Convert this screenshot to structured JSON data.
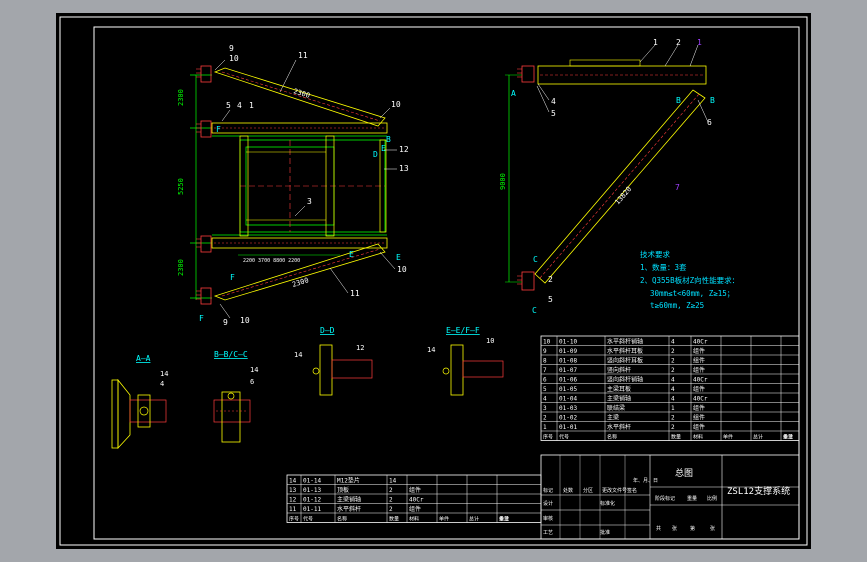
{
  "colors": {
    "background_outer": "#a3a6ab",
    "sheet": "#000000",
    "frame": "#ffffff",
    "dimension": "#00ff00",
    "part": "#ffff00",
    "accent": "#ff3c3c",
    "leader": "#00ffff",
    "purple": "#a040ff",
    "note": "#00e0ff"
  },
  "top_view": {
    "balloons": [
      "9",
      "10",
      "11",
      "5",
      "4",
      "1",
      "10",
      "12",
      "13",
      "3",
      "11",
      "10",
      "9",
      "10"
    ],
    "dims": [
      "2300",
      "2300",
      "5250",
      "2300",
      "2300"
    ],
    "mid_text": "2200   3700  8800  2200",
    "sections": [
      "B",
      "D",
      "E",
      "F",
      "F",
      "F",
      "E",
      "E"
    ]
  },
  "side_view": {
    "balloons": [
      "1",
      "2",
      "1",
      "4",
      "5",
      "6",
      "7",
      "2",
      "5"
    ],
    "dims": [
      "9000",
      "13820"
    ],
    "letters": [
      "A",
      "B",
      "B",
      "C",
      "C"
    ]
  },
  "notes": {
    "title": "技术要求",
    "line1": "1、数量：3套",
    "line2": "2、Q355B板材Z向性能要求：",
    "line3": "30mm≤t<60mm, Z≥15；",
    "line4": "t≥60mm, Z≥25"
  },
  "section_views": {
    "aa": {
      "title": "A—A",
      "b1": "14",
      "b2": "4"
    },
    "bc": {
      "title": "B—B/C—C",
      "b1": "14",
      "b2": "6"
    },
    "dd": {
      "title": "D—D",
      "b1": "14",
      "b2": "12"
    },
    "ef": {
      "title": "E—E/F—F",
      "b1": "14",
      "b2": "10"
    }
  },
  "bom_right": {
    "rows": [
      [
        "10",
        "01-10",
        "水平斜杆销轴",
        "4",
        "40Cr"
      ],
      [
        "9",
        "01-09",
        "水平斜杆耳板",
        "2",
        "组件"
      ],
      [
        "8",
        "01-08",
        "竖向斜杆耳板",
        "2",
        "组件"
      ],
      [
        "7",
        "01-07",
        "竖向斜杆",
        "2",
        "组件"
      ],
      [
        "6",
        "01-06",
        "竖向斜杆销轴",
        "4",
        "40Cr"
      ],
      [
        "5",
        "01-05",
        "主梁耳板",
        "4",
        "组件"
      ],
      [
        "4",
        "01-04",
        "主梁销轴",
        "4",
        "40Cr"
      ],
      [
        "3",
        "01-03",
        "联结梁",
        "1",
        "组件"
      ],
      [
        "2",
        "01-02",
        "主梁",
        "2",
        "组件"
      ],
      [
        "1",
        "01-01",
        "水平斜杆",
        "2",
        "组件"
      ]
    ],
    "header": [
      "序号",
      "代号",
      "名称",
      "数量",
      "材料",
      "单件",
      "总计",
      "重量",
      "备注"
    ]
  },
  "bom_left": {
    "rows": [
      [
        "14",
        "01-14",
        "M12垫片",
        "14",
        ""
      ],
      [
        "13",
        "01-13",
        "顶板",
        "2",
        "组件"
      ],
      [
        "12",
        "01-12",
        "主梁销轴",
        "2",
        "40Cr"
      ],
      [
        "11",
        "01-11",
        "水平斜杆",
        "2",
        "组件"
      ]
    ],
    "header": [
      "序号",
      "代号",
      "名称",
      "数量",
      "材料",
      "单件",
      "总计",
      "重量",
      "备注"
    ]
  },
  "title_block": {
    "drawing_title": "总图",
    "product_name": "ZSL12支撑系统",
    "labels": [
      "标记",
      "处数",
      "分区",
      "更改文件号",
      "签名",
      "年、月、日",
      "设计",
      "标准化",
      "审核",
      "工艺",
      "批准",
      "阶段标记",
      "重量",
      "比例",
      "共",
      "张",
      "第",
      "张"
    ]
  }
}
